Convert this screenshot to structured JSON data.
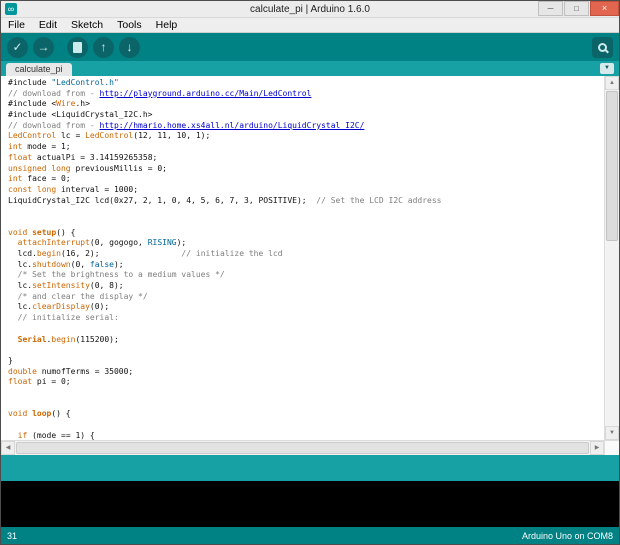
{
  "window": {
    "title": "calculate_pi | Arduino 1.6.0",
    "controls": {
      "minimize": "─",
      "maximize": "□",
      "close": "×"
    }
  },
  "menu": {
    "items": [
      "File",
      "Edit",
      "Sketch",
      "Tools",
      "Help"
    ]
  },
  "toolbar": {
    "verify_glyph": "✓",
    "upload_glyph": "→",
    "open_glyph": "↑",
    "save_glyph": "↓",
    "buttons": [
      "verify",
      "upload",
      "new",
      "open",
      "save",
      "serial-monitor"
    ]
  },
  "tabs": {
    "active_label": "calculate_pi",
    "dropdown_glyph": "▼"
  },
  "scrollbars": {
    "up": "▲",
    "down": "▼",
    "left": "◀",
    "right": "▶"
  },
  "editor": {
    "lines": [
      [
        [
          "p",
          "#include "
        ],
        [
          "s",
          "\"LedControl.h\""
        ]
      ],
      [
        [
          "c",
          "// download from - "
        ],
        [
          "u",
          "http://playground.arduino.cc/Main/LedControl"
        ]
      ],
      [
        [
          "p",
          "#include <"
        ],
        [
          "k",
          "Wire"
        ],
        [
          "p",
          ".h>"
        ]
      ],
      [
        [
          "p",
          "#include <LiquidCrystal_I2C.h>"
        ]
      ],
      [
        [
          "c",
          "// download from - "
        ],
        [
          "u",
          "http://hmario.home.xs4all.nl/arduino/LiquidCrystal_I2C/"
        ]
      ],
      [
        [
          "k",
          "LedControl"
        ],
        [
          "p",
          " lc = "
        ],
        [
          "k",
          "LedControl"
        ],
        [
          "p",
          "(12, 11, 10, 1);"
        ]
      ],
      [
        [
          "k",
          "int"
        ],
        [
          "p",
          " mode = 1;"
        ]
      ],
      [
        [
          "k",
          "float"
        ],
        [
          "p",
          " actualPi = 3.14159265358;"
        ]
      ],
      [
        [
          "k",
          "unsigned long"
        ],
        [
          "p",
          " previousMillis = 0;"
        ]
      ],
      [
        [
          "k",
          "int"
        ],
        [
          "p",
          " face = 0;"
        ]
      ],
      [
        [
          "k",
          "const long"
        ],
        [
          "p",
          " interval = 1000;"
        ]
      ],
      [
        [
          "p",
          "LiquidCrystal_I2C lcd(0x27, 2, 1, 0, 4, 5, 6, 7, 3, POSITIVE);  "
        ],
        [
          "c",
          "// Set the LCD I2C address"
        ]
      ],
      [],
      [],
      [
        [
          "k",
          "void "
        ],
        [
          "b",
          "setup"
        ],
        [
          "p",
          "() {"
        ]
      ],
      [
        [
          "p",
          "  "
        ],
        [
          "k",
          "attachInterrupt"
        ],
        [
          "p",
          "(0, gogogo, "
        ],
        [
          "l",
          "RISING"
        ],
        [
          "p",
          ");"
        ]
      ],
      [
        [
          "p",
          "  lcd."
        ],
        [
          "k",
          "begin"
        ],
        [
          "p",
          "(16, 2);                 "
        ],
        [
          "c",
          "// initialize the lcd"
        ]
      ],
      [
        [
          "p",
          "  lc."
        ],
        [
          "k",
          "shutdown"
        ],
        [
          "p",
          "(0, "
        ],
        [
          "l",
          "false"
        ],
        [
          "p",
          ");"
        ]
      ],
      [
        [
          "p",
          "  "
        ],
        [
          "c",
          "/* Set the brightness to a medium values */"
        ]
      ],
      [
        [
          "p",
          "  lc."
        ],
        [
          "k",
          "setIntensity"
        ],
        [
          "p",
          "(0, 8);"
        ]
      ],
      [
        [
          "p",
          "  "
        ],
        [
          "c",
          "/* and clear the display */"
        ]
      ],
      [
        [
          "p",
          "  lc."
        ],
        [
          "k",
          "clearDisplay"
        ],
        [
          "p",
          "(0);"
        ]
      ],
      [
        [
          "p",
          "  "
        ],
        [
          "c",
          "// initialize serial:"
        ]
      ],
      [],
      [
        [
          "p",
          "  "
        ],
        [
          "b",
          "Serial"
        ],
        [
          "p",
          "."
        ],
        [
          "k",
          "begin"
        ],
        [
          "p",
          "(115200);"
        ]
      ],
      [],
      [
        [
          "p",
          "}"
        ]
      ],
      [
        [
          "k",
          "double"
        ],
        [
          "p",
          " numofTerms = 35000;"
        ]
      ],
      [
        [
          "k",
          "float"
        ],
        [
          "p",
          " pi = 0;"
        ]
      ],
      [],
      [],
      [
        [
          "k",
          "void "
        ],
        [
          "b",
          "loop"
        ],
        [
          "p",
          "() {"
        ]
      ],
      [],
      [
        [
          "p",
          "  "
        ],
        [
          "k",
          "if"
        ],
        [
          "p",
          " (mode == 1) {"
        ]
      ]
    ]
  },
  "status": {
    "message": ""
  },
  "console": {
    "text": ""
  },
  "bottombar": {
    "line_number": "31",
    "board_port": "Arduino Uno on COM8"
  },
  "colors": {
    "toolbar_teal": "#008184",
    "tabbar_teal": "#17a1a5",
    "button_teal": "#0b6468",
    "close_red": "#e2664f",
    "keyword_orange": "#cc6600",
    "comment_gray": "#7e7e7e",
    "literal_blue": "#006699",
    "link_blue": "#0000cc"
  }
}
